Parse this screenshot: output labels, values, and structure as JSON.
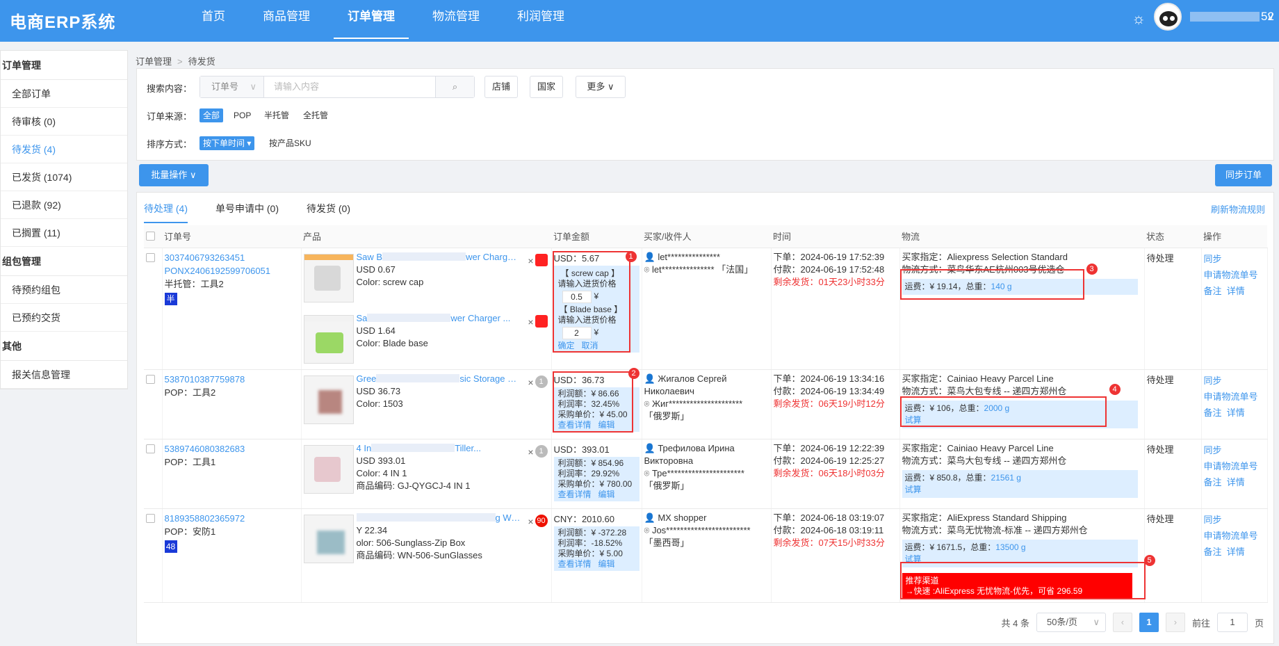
{
  "app": {
    "title": "电商ERP系统",
    "user": "52"
  },
  "nav": {
    "items": [
      {
        "label": "首页",
        "active": false
      },
      {
        "label": "商品管理",
        "active": false
      },
      {
        "label": "订单管理",
        "active": true
      },
      {
        "label": "物流管理",
        "active": false
      },
      {
        "label": "利润管理",
        "active": false
      }
    ]
  },
  "sidebar": {
    "groups": [
      {
        "title": "订单管理",
        "items": [
          "全部订单",
          "待审核 (0)",
          "待发货 (4)",
          "已发货 (1074)",
          "已退款 (92)",
          "已搁置 (11)"
        ]
      },
      {
        "title": "组包管理",
        "items": [
          "待预约组包",
          "已预约交货"
        ]
      },
      {
        "title": "其他",
        "items": [
          "报关信息管理"
        ]
      }
    ],
    "active_item": "待发货 (4)"
  },
  "breadcrumb": {
    "root": "订单管理",
    "current": "待发货"
  },
  "filter": {
    "search_label": "搜索内容：",
    "search_select": "订单号",
    "search_placeholder": "请输入内容",
    "store_button": "店铺",
    "country_button": "国家",
    "more_button": "更多",
    "source_label": "订单来源：",
    "sources": [
      "全部",
      "POP",
      "半托管",
      "全托管"
    ],
    "sort_label": "排序方式：",
    "sort_active": "按下单时间",
    "sort_other": "按产品SKU"
  },
  "toolbar": {
    "bulk_label": "批量操作",
    "sync_label": "同步订单"
  },
  "tabs": [
    {
      "label": "待处理 (4)",
      "active": true
    },
    {
      "label": "单号申请中 (0)",
      "active": false
    },
    {
      "label": "待发货 (0)",
      "active": false
    }
  ],
  "refresh_label": "刷新物流规则",
  "table": {
    "headers": [
      "订单号",
      "产品",
      "订单金额",
      "买家/收件人",
      "时间",
      "物流",
      "状态",
      "操作"
    ]
  },
  "orders": [
    {
      "order_no": "3037406793263451",
      "order_no2": "PONX2406192599706051",
      "type": "半托管：工具2",
      "badge": "半",
      "products": [
        {
          "title_start": "Saw B",
          "title_end": "wer Charger ...",
          "price": "USD 0.67",
          "attr": "Color: screw cap",
          "qty": ""
        },
        {
          "title_start": "Sa",
          "title_end": "wer Charger ...",
          "price": "USD 1.64",
          "attr": "Color: Blade base",
          "qty": ""
        }
      ],
      "amount": "USD：5.67",
      "price_edit": [
        {
          "name": "【 screw cap 】",
          "hint": "请输入进货价格",
          "value": "0.5",
          "unit": "¥"
        },
        {
          "name": "【 Blade base 】",
          "hint": "请输入进货价格",
          "value": "2",
          "unit": "¥"
        }
      ],
      "confirm": "确定",
      "cancel": "取消",
      "buyer": "let***************",
      "receiver": "let***************",
      "country": "「法国」",
      "order_time": "下单：2024-06-19 17:52:39",
      "pay_time": "付款：2024-06-19 17:52:48",
      "remaining": "剩余发货：01天23小时33分",
      "log_buyer": "买家指定：Aliexpress Selection Standard",
      "log_method": "物流方式：菜鸟华东AE杭州003号优选仓",
      "freight": "运费：¥ 19.14，总重：",
      "weight": "140 g",
      "trial": "",
      "status": "待处理",
      "ops": [
        "同步",
        "申请物流单号",
        "备注",
        "详情"
      ],
      "marker": "1"
    },
    {
      "order_no": "5387010387759878",
      "type": "POP：工具2",
      "badge": "",
      "products": [
        {
          "title_start": "Gree",
          "title_end": "sic Storage B...",
          "price": "USD 36.73",
          "attr": "Color: 1503",
          "qty": "1"
        }
      ],
      "amount": "USD：36.73",
      "profit": "利润额：¥ 86.66",
      "profit_rate": "利润率：32.45%",
      "cost": "采购单价：¥ 45.00",
      "view_detail": "查看详情",
      "edit": "编辑",
      "buyer": "Жигалов Сергей Николаевич",
      "receiver": "Жиг*********************",
      "country": "「俄罗斯」",
      "order_time": "下单：2024-06-19 13:34:16",
      "pay_time": "付款：2024-06-19 13:34:49",
      "remaining": "剩余发货：06天19小时12分",
      "log_buyer": "买家指定：Cainiao Heavy Parcel Line",
      "log_method": "物流方式：菜鸟大包专线 -- 递四方郑州仓",
      "freight": "运费：¥ 106，总重：",
      "weight": "2000 g",
      "trial": "试算",
      "status": "待处理",
      "ops": [
        "同步",
        "申请物流单号",
        "备注",
        "详情"
      ]
    },
    {
      "order_no": "5389746080382683",
      "type": "POP：工具1",
      "badge": "",
      "products": [
        {
          "title_start": "4 In",
          "title_end": "Tiller...",
          "price": "USD 393.01",
          "attr": "Color: 4 IN 1",
          "attr2": "商品编码: GJ-QYGCJ-4 IN 1",
          "qty": "1"
        }
      ],
      "amount": "USD：393.01",
      "profit": "利润额：¥ 854.96",
      "profit_rate": "利润率：29.92%",
      "cost": "采购单价：¥ 780.00",
      "view_detail": "查看详情",
      "edit": "编辑",
      "buyer": "Трефилова Ирина Викторовна",
      "receiver": "Тре**********************",
      "country": "「俄罗斯」",
      "order_time": "下单：2024-06-19 12:22:39",
      "pay_time": "付款：2024-06-19 12:25:27",
      "remaining": "剩余发货：06天18小时03分",
      "log_buyer": "买家指定：Cainiao Heavy Parcel Line",
      "log_method": "物流方式：菜鸟大包专线 -- 递四方郑州仓",
      "freight": "运费：¥ 850.8，总重：",
      "weight": "21561 g",
      "trial": "试算",
      "status": "待处理",
      "ops": [
        "同步",
        "申请物流单号",
        "备注",
        "详情"
      ]
    },
    {
      "order_no": "8189358802365972",
      "type": "POP：安防1",
      "badge": "48",
      "products": [
        {
          "title_start": "",
          "title_end": "g Weldi...",
          "price": "Y 22.34",
          "attr": "olor: 506-Sunglass-Zip Box",
          "attr2": "商品编码: WN-506-SunGlasses",
          "qty": "90"
        }
      ],
      "amount": "CNY：2010.60",
      "profit": "利润额：¥ -372.28",
      "profit_rate": "利润率：-18.52%",
      "cost": "采购单价：¥ 5.00",
      "view_detail": "查看详情",
      "edit": "编辑",
      "buyer": "MX shopper",
      "receiver": "Jos************************",
      "country": "「墨西哥」",
      "order_time": "下单：2024-06-18 03:19:07",
      "pay_time": "付款：2024-06-18 03:19:11",
      "remaining": "剩余发货：07天15小时33分",
      "log_buyer": "买家指定：AliExpress Standard Shipping",
      "log_method": "物流方式：菜鸟无忧物流-标准 -- 递四方郑州仓",
      "freight": "运费：¥ 1671.5，总重：",
      "weight": "13500 g",
      "trial": "试算",
      "recommend_title": "推荐渠道",
      "recommend_text": "→快速 :AliExpress 无忧物流-优先，可省 296.59",
      "status": "待处理",
      "ops": [
        "同步",
        "申请物流单号",
        "备注",
        "详情"
      ]
    }
  ],
  "markers": [
    "1",
    "2",
    "3",
    "4",
    "5"
  ],
  "pager": {
    "total": "共 4 条",
    "size": "50条/页",
    "current": "1",
    "goto": "前往",
    "goto_value": "1",
    "page_unit": "页"
  },
  "colors": {
    "primary": "#3d95ec",
    "alert": "#e33"
  }
}
